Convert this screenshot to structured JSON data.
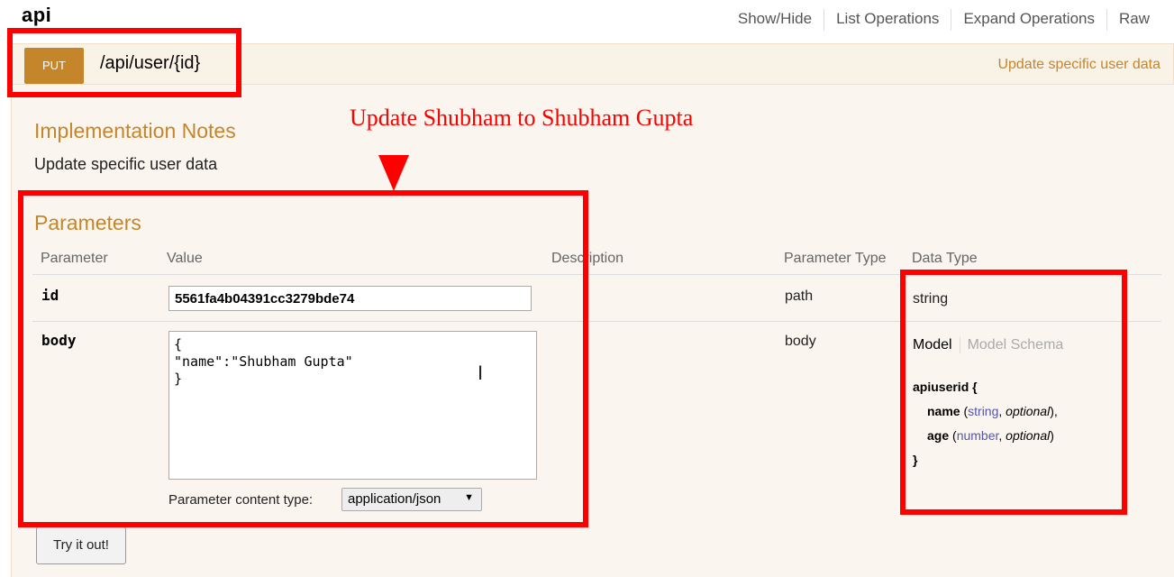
{
  "resource": {
    "name": "api"
  },
  "header_links": [
    "Show/Hide",
    "List Operations",
    "Expand Operations",
    "Raw"
  ],
  "operation": {
    "method": "PUT",
    "path": "/api/user/{id}",
    "summary": "Update specific user data"
  },
  "implementation_notes": {
    "title": "Implementation Notes",
    "text": "Update specific user data"
  },
  "parameters": {
    "title": "Parameters",
    "columns": [
      "Parameter",
      "Value",
      "Description",
      "Parameter Type",
      "Data Type"
    ],
    "rows": [
      {
        "name": "id",
        "value": "5561fa4b04391cc3279bde74",
        "param_type": "path",
        "data_type": "string"
      },
      {
        "name": "body",
        "value": "{\n\"name\":\"Shubham Gupta\"\n}",
        "param_type": "body"
      }
    ],
    "content_type_label": "Parameter content type:",
    "content_type_value": "application/json"
  },
  "model": {
    "tab_model": "Model",
    "tab_schema": "Model Schema",
    "name": "apiuserid {",
    "close": "}",
    "fields": [
      {
        "name": "name",
        "type": "string",
        "opt": "optional",
        "suffix": "),"
      },
      {
        "name": "age",
        "type": "number",
        "opt": "optional",
        "suffix": ")"
      }
    ]
  },
  "try_button": "Try it out!",
  "annotation": {
    "text": "Update Shubham to Shubham Gupta",
    "color": "#ff0000"
  },
  "icons": {
    "text_cursor": "I-beam-cursor-icon",
    "resize": "resize-grip-icon",
    "dropdown": "triangle-down-icon"
  },
  "colors": {
    "method": "#c5862b",
    "section_title": "#c5862b",
    "panel_bg": "#faf5ee"
  }
}
